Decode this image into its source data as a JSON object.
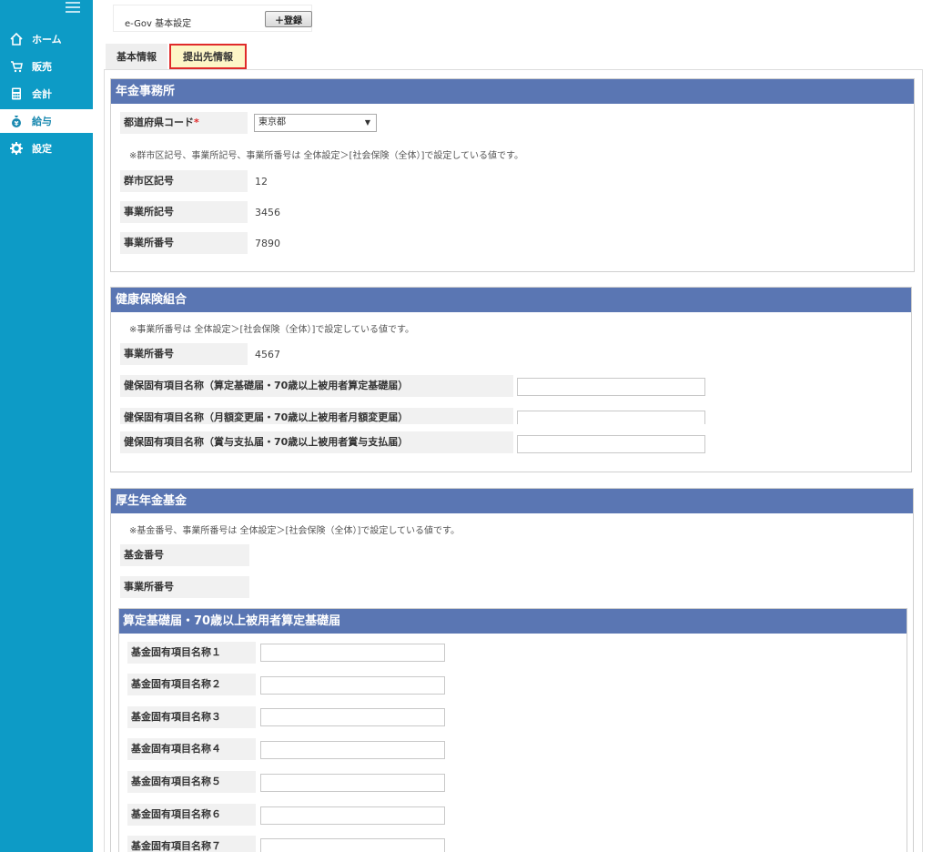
{
  "sidebar": {
    "items": [
      {
        "label": "ホーム",
        "icon": "home-icon"
      },
      {
        "label": "販売",
        "icon": "cart-icon"
      },
      {
        "label": "会計",
        "icon": "calculator-icon"
      },
      {
        "label": "給与",
        "icon": "money-bag-icon"
      },
      {
        "label": "設定",
        "icon": "gear-icon"
      }
    ],
    "active_index": 3
  },
  "toolbar": {
    "title": "e-Gov 基本設定",
    "register_label": "＋登録"
  },
  "tabs": [
    {
      "label": "基本情報"
    },
    {
      "label": "提出先情報"
    }
  ],
  "pension_office": {
    "title": "年金事務所",
    "prefecture_label": "都道府県コード",
    "required_mark": "*",
    "prefecture_value": "東京都",
    "note": "※群市区記号、事業所記号、事業所番号は 全体設定＞[社会保険（全体）]で設定している値です。",
    "rows": [
      {
        "label": "群市区記号",
        "value": "12"
      },
      {
        "label": "事業所記号",
        "value": "3456"
      },
      {
        "label": "事業所番号",
        "value": "7890"
      }
    ]
  },
  "health_union": {
    "title": "健康保険組合",
    "note": "※事業所番号は 全体設定＞[社会保険（全体）]で設定している値です。",
    "office_label": "事業所番号",
    "office_value": "4567",
    "fields": [
      {
        "label": "健保固有項目名称（算定基礎届・70歳以上被用者算定基礎届）",
        "value": ""
      },
      {
        "label": "健保固有項目名称（月額変更届・70歳以上被用者月額変更届）",
        "value": ""
      },
      {
        "label": "健保固有項目名称（賞与支払届・70歳以上被用者賞与支払届）",
        "value": ""
      }
    ]
  },
  "pension_fund": {
    "title": "厚生年金基金",
    "note": "※基金番号、事業所番号は 全体設定＞[社会保険（全体）]で設定している値です。",
    "rows": [
      {
        "label": "基金番号",
        "value": ""
      },
      {
        "label": "事業所番号",
        "value": ""
      }
    ],
    "sub": {
      "title": "算定基礎届・70歳以上被用者算定基礎届",
      "fields": [
        {
          "label": "基金固有項目名称１",
          "value": ""
        },
        {
          "label": "基金固有項目名称２",
          "value": ""
        },
        {
          "label": "基金固有項目名称３",
          "value": ""
        },
        {
          "label": "基金固有項目名称４",
          "value": ""
        },
        {
          "label": "基金固有項目名称５",
          "value": ""
        },
        {
          "label": "基金固有項目名称６",
          "value": ""
        },
        {
          "label": "基金固有項目名称７",
          "value": ""
        }
      ]
    }
  }
}
